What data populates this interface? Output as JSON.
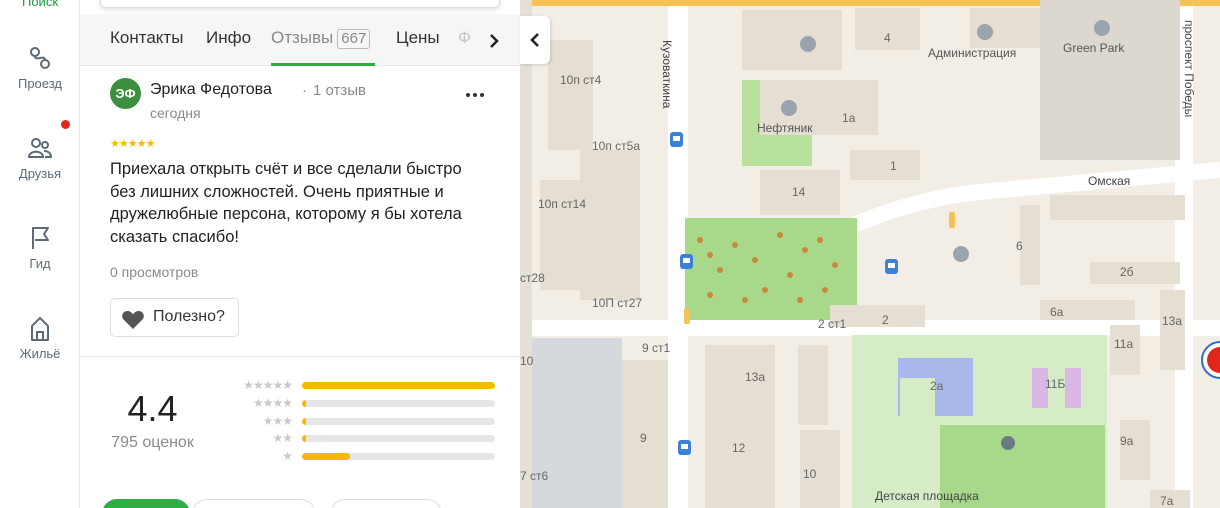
{
  "rail": {
    "search_label": "Поиск",
    "items": [
      {
        "label": "Проезд",
        "icon": "route-icon"
      },
      {
        "label": "Друзья",
        "icon": "friends-icon"
      },
      {
        "label": "Гид",
        "icon": "flag-icon"
      },
      {
        "label": "Жильё",
        "icon": "house-icon"
      }
    ]
  },
  "tabs": {
    "contacts": "Контакты",
    "info": "Инфо",
    "reviews": "Отзывы",
    "reviews_count": "667",
    "prices": "Цены",
    "faded": "Ф"
  },
  "review": {
    "avatar_initials": "ЭФ",
    "author": "Эрика Федотова",
    "author_reviews": "1 отзыв",
    "date": "сегодня",
    "stars": "★★★★★",
    "text": "Приехала открыть счёт и все сделали быстро без лишних сложностей. Очень приятные и дружелюбные персона, которому я бы хотела сказать спасибо!",
    "views": "0 просмотров",
    "useful_label": "Полезно?"
  },
  "rating": {
    "value": "4.4",
    "count": "795 оценок",
    "distribution": [
      {
        "stars": "★★★★★",
        "fraction": 1.0
      },
      {
        "stars": "★★★★",
        "fraction": 0.02
      },
      {
        "stars": "★★★",
        "fraction": 0.01
      },
      {
        "stars": "★★",
        "fraction": 0.01
      },
      {
        "stars": "★",
        "fraction": 0.25
      }
    ]
  },
  "colors": {
    "accent_green": "#2eae42",
    "star_yellow": "#f5b900",
    "notification_red": "#e2261c",
    "map_park": "#a8d98a"
  },
  "map": {
    "labels": {
      "street_kuzovatkina": "Кузоваткина",
      "street_omskaya": "Омская",
      "street_pobedy": "проспект Победы",
      "admin": "Администрация",
      "green_park": "Green Park",
      "neftyanik": "Нефтяник",
      "playground": "Детская площадка",
      "h4": "4",
      "h1a": "1а",
      "h1": "1",
      "h14": "14",
      "h6": "6",
      "h2b": "2б",
      "h2": "2",
      "h2st1": "2 ст1",
      "h6a": "6а",
      "h11a": "11а",
      "h13a": "13а",
      "h2a": "2а",
      "h11b": "11Б",
      "h9a": "9а",
      "h7a": "7а",
      "h13a2": "13а",
      "h12": "12",
      "h10": "10",
      "h9": "9",
      "h10pst4": "10п ст4",
      "h10pst5a": "10п ст5а",
      "h10pst14": "10п ст14",
      "hst28": "ст28",
      "h10pst27": "10П ст27",
      "h9st1": "9 ст1",
      "hst6": "7 ст6",
      "h10left": "10"
    }
  }
}
